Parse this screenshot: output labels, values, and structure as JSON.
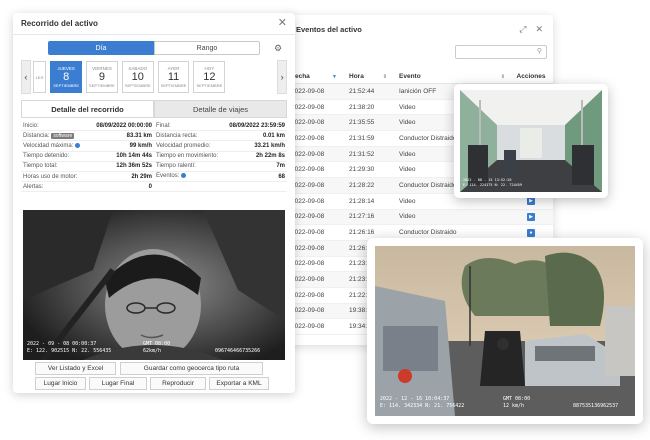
{
  "left": {
    "title": "Recorrido del activo",
    "modes": [
      "Día",
      "Rango"
    ],
    "days": [
      {
        "name": "",
        "num": "",
        "month": "LES"
      },
      {
        "name": "JUEVES",
        "num": "8",
        "month": "SEPTIEMBRE"
      },
      {
        "name": "VIERNES",
        "num": "9",
        "month": "SEPTIEMBRE"
      },
      {
        "name": "SABADO",
        "num": "10",
        "month": "SEPTIEMBRE"
      },
      {
        "name": "AYER",
        "num": "11",
        "month": "SEPTIEMBRE"
      },
      {
        "name": "HOY",
        "num": "12",
        "month": "SEPTIEMBRE"
      }
    ],
    "tabs": [
      "Detalle del recorrido",
      "Detalle de viajes"
    ],
    "stats_left": [
      {
        "label": "Inicio:",
        "value": "08/09/2022 00:00:00"
      },
      {
        "label": "Distancia:",
        "badge": "software",
        "value": "83.31 km"
      },
      {
        "label": "Velocidad máxima:",
        "value": "99 km/h"
      },
      {
        "label": "Tiempo detenido:",
        "value": "10h 14m 44s"
      },
      {
        "label": "Tiempo total:",
        "value": "12h 36m 52s"
      },
      {
        "label": "Horas uso de motor:",
        "value": "2h 29m"
      },
      {
        "label": "Alertas:",
        "value": "0"
      }
    ],
    "stats_right": [
      {
        "label": "Final:",
        "value": "08/09/2022 23:59:59"
      },
      {
        "label": "Distancia recta:",
        "value": "0.01 km"
      },
      {
        "label": "Velocidad promedio:",
        "value": "33.21 km/h"
      },
      {
        "label": "Tiempo en movimiento:",
        "value": "2h 22m 8s"
      },
      {
        "label": "Tiempo ralentí:",
        "value": "7m"
      },
      {
        "label": "Eventos:",
        "value": "68"
      }
    ],
    "camera": {
      "stamp_line1": "2022 - 09 - 08  00:00:37",
      "stamp_line2": "E: 122. 902515  N: 22. 556435",
      "gmt": "GMT 08:00",
      "speed": "62km/h",
      "device_id": "096746466735266"
    },
    "buttons_row1": [
      "Ver Listado y Excel",
      "Guardar como geocerca tipo ruta"
    ],
    "buttons_row2": [
      "Lugar Inicio",
      "Lugar Final",
      "Reproducir",
      "Exportar a KML"
    ]
  },
  "right": {
    "title": "Eventos del activo",
    "columns": [
      "Fecha",
      "Hora",
      "Evento",
      "Acciones"
    ],
    "rows": [
      {
        "date": "2022-09-08",
        "time": "21:52:44",
        "event": "Ianición OFF"
      },
      {
        "date": "2022-09-08",
        "time": "21:38:20",
        "event": "Video"
      },
      {
        "date": "2022-09-08",
        "time": "21:35:55",
        "event": "Video"
      },
      {
        "date": "2022-09-08",
        "time": "21:31:59",
        "event": "Conductor Distraido"
      },
      {
        "date": "2022-09-08",
        "time": "21:31:52",
        "event": "Video"
      },
      {
        "date": "2022-09-08",
        "time": "21:29:30",
        "event": "Video"
      },
      {
        "date": "2022-09-08",
        "time": "21:28:22",
        "event": "Conductor Distraido"
      },
      {
        "date": "2022-09-08",
        "time": "21:28:14",
        "event": "Video"
      },
      {
        "date": "2022-09-08",
        "time": "21:27:16",
        "event": "Video"
      },
      {
        "date": "2022-09-08",
        "time": "21:26:16",
        "event": "Conductor Distraido"
      },
      {
        "date": "2022-09-08",
        "time": "21:26:0",
        "event": ""
      },
      {
        "date": "2022-09-08",
        "time": "21:23:2",
        "event": ""
      },
      {
        "date": "2022-09-08",
        "time": "21:23:1",
        "event": ""
      },
      {
        "date": "2022-09-08",
        "time": "21:22:0",
        "event": ""
      },
      {
        "date": "2022-09-08",
        "time": "19:38:5",
        "event": ""
      },
      {
        "date": "2022-09-08",
        "time": "19:34:3",
        "event": ""
      }
    ]
  },
  "bus_card": {
    "stamp_line1": "2022 - 08 - 15  13:52:26",
    "stamp_line2": "E: 114. 224375  N: 22. 724459"
  },
  "street_card": {
    "stamp_line1": "2022 - 12 - 16  10:04:37",
    "stamp_line2": "E: 114. 342334  N: 21. 756422",
    "gmt": "GMT 08:00",
    "speed": "12 km/h",
    "device_id": "887535136962537"
  }
}
